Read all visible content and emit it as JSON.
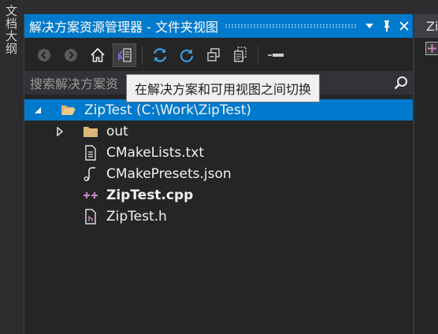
{
  "left_strip": {
    "vertical_tab_label": "文档大纲"
  },
  "panel": {
    "title": "解决方案资源管理器 - 文件夹视图",
    "title_buttons": [
      "dropdown",
      "pin",
      "close"
    ]
  },
  "toolbar": {
    "buttons": [
      "back",
      "forward",
      "home",
      "switch-views",
      "sync",
      "refresh",
      "collapse-all",
      "show-all-files",
      "properties"
    ]
  },
  "search": {
    "placeholder": "搜索解决方案资源管理器 - 文件夹视图 (Ctrl+;)",
    "value": "搜索解决方案资"
  },
  "tooltip": {
    "text": "在解决方案和可用视图之间切换"
  },
  "tree": {
    "root": {
      "label": "ZipTest (C:\\Work\\ZipTest)",
      "icon": "folder-open-icon"
    },
    "items": [
      {
        "label": "out",
        "icon": "folder-icon",
        "bold": false
      },
      {
        "label": "CMakeLists.txt",
        "icon": "text-file-icon",
        "bold": false
      },
      {
        "label": "CMakePresets.json",
        "icon": "json-file-icon",
        "bold": false
      },
      {
        "label": "ZipTest.cpp",
        "icon": "cpp-file-icon",
        "bold": true
      },
      {
        "label": "ZipTest.h",
        "icon": "header-file-icon",
        "bold": false
      }
    ]
  },
  "right_panel": {
    "title": "Zi"
  },
  "colors": {
    "accent": "#007acc",
    "panel_bg": "#252526",
    "folder": "#dcb67a",
    "cpp": "#c586c0",
    "vs_purple": "#8661c5"
  }
}
